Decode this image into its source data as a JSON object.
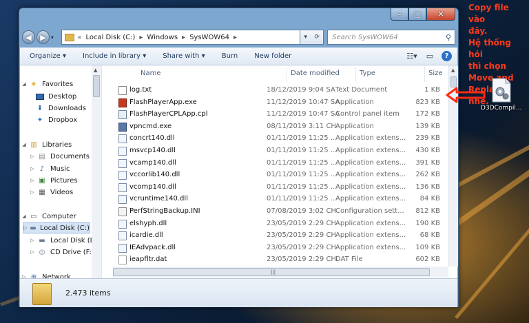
{
  "window": {
    "controls": {
      "minimize": "–",
      "maximize": "□",
      "close": "✕"
    }
  },
  "address": {
    "overflow": "«",
    "path": [
      "Local Disk (C:)",
      "Windows",
      "SysWOW64"
    ],
    "separator": "▸",
    "search_placeholder": "Search SysWOW64"
  },
  "toolbar": {
    "organize": "Organize ▾",
    "include_in_library": "Include in library ▾",
    "share_with": "Share with ▾",
    "burn": "Burn",
    "new_folder": "New folder"
  },
  "nav": {
    "favorites": "Favorites",
    "desktop": "Desktop",
    "downloads": "Downloads",
    "dropbox": "Dropbox",
    "libraries": "Libraries",
    "documents": "Documents",
    "music": "Music",
    "pictures": "Pictures",
    "videos": "Videos",
    "computer": "Computer",
    "local_c": "Local Disk (C:)",
    "local_d": "Local Disk (D:)",
    "cd_drive": "CD Drive (F:)",
    "network": "Network"
  },
  "columns": {
    "name": "Name",
    "date": "Date modified",
    "type": "Type",
    "size": "Size"
  },
  "files": [
    {
      "name": "log.txt",
      "date": "18/12/2019 9:04 SA",
      "type": "Text Document",
      "size": "1 KB",
      "icon": "text-file"
    },
    {
      "name": "FlashPlayerApp.exe",
      "date": "11/12/2019 10:47 SA",
      "type": "Application",
      "size": "823 KB",
      "icon": "flash-app"
    },
    {
      "name": "FlashPlayerCPLApp.cpl",
      "date": "11/12/2019 10:47 SA",
      "type": "Control panel item",
      "size": "172 KB",
      "icon": "control-panel"
    },
    {
      "name": "vpncmd.exe",
      "date": "08/11/2019 3:11 CH",
      "type": "Application",
      "size": "139 KB",
      "icon": "app"
    },
    {
      "name": "concrt140.dll",
      "date": "01/11/2019 11:25 ...",
      "type": "Application extens...",
      "size": "239 KB",
      "icon": "dll"
    },
    {
      "name": "msvcp140.dll",
      "date": "01/11/2019 11:25 ...",
      "type": "Application extens...",
      "size": "430 KB",
      "icon": "dll"
    },
    {
      "name": "vcamp140.dll",
      "date": "01/11/2019 11:25 ...",
      "type": "Application extens...",
      "size": "391 KB",
      "icon": "dll"
    },
    {
      "name": "vccorlib140.dll",
      "date": "01/11/2019 11:25 ...",
      "type": "Application extens...",
      "size": "262 KB",
      "icon": "dll"
    },
    {
      "name": "vcomp140.dll",
      "date": "01/11/2019 11:25 ...",
      "type": "Application extens...",
      "size": "136 KB",
      "icon": "dll"
    },
    {
      "name": "vcruntime140.dll",
      "date": "01/11/2019 11:25 ...",
      "type": "Application extens...",
      "size": "84 KB",
      "icon": "dll"
    },
    {
      "name": "PerfStringBackup.INI",
      "date": "07/08/2019 3:02 CH",
      "type": "Configuration sett...",
      "size": "812 KB",
      "icon": "ini"
    },
    {
      "name": "elshyph.dll",
      "date": "23/05/2019 2:29 CH",
      "type": "Application extens...",
      "size": "190 KB",
      "icon": "dll"
    },
    {
      "name": "icardie.dll",
      "date": "23/05/2019 2:29 CH",
      "type": "Application extens...",
      "size": "68 KB",
      "icon": "dll"
    },
    {
      "name": "IEAdvpack.dll",
      "date": "23/05/2019 2:29 CH",
      "type": "Application extens...",
      "size": "109 KB",
      "icon": "dll"
    },
    {
      "name": "ieapfltr.dat",
      "date": "23/05/2019 2:29 CH",
      "type": "DAT File",
      "size": "602 KB",
      "icon": "dat"
    }
  ],
  "status": {
    "item_count": "2.473 items"
  },
  "annotation": {
    "lines": [
      "Copy file vào",
      "đây.",
      "Hệ thống hỏi",
      "thì chọn",
      "Move and",
      "Replace nhé."
    ],
    "color": "#ff3a1a"
  },
  "desktop_icon": {
    "label": "D3DCompil..."
  }
}
